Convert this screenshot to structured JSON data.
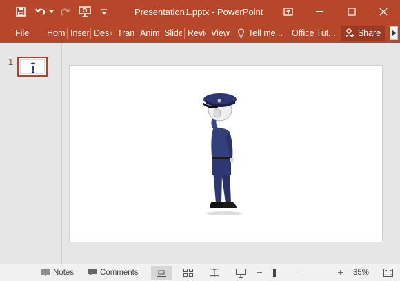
{
  "titlebar": {
    "title": "Presentation1.pptx - PowerPoint",
    "accent_color": "#b7472a",
    "quick_access": [
      "save-icon",
      "undo-icon",
      "undo-dropdown-icon",
      "redo-icon",
      "present-from-start-icon",
      "customize-qat-icon"
    ],
    "window_controls": [
      "ribbon-display-options-icon",
      "minimize-icon",
      "maximize-icon",
      "close-icon"
    ]
  },
  "ribbon": {
    "tabs": [
      {
        "label": "File"
      },
      {
        "label": "Home"
      },
      {
        "label": "Insert"
      },
      {
        "label": "Design"
      },
      {
        "label": "Transitions"
      },
      {
        "label": "Animations"
      },
      {
        "label": "Slide Show"
      },
      {
        "label": "Review"
      },
      {
        "label": "View"
      }
    ],
    "tell_me": "Tell me...",
    "office_tut": "Office Tut...",
    "share": "Share"
  },
  "thumbnails": {
    "items": [
      {
        "number": "1",
        "selected": true
      }
    ]
  },
  "slide": {
    "content_image": "police-officer-stick-figure-saluting"
  },
  "statusbar": {
    "notes": "Notes",
    "comments": "Comments",
    "views": [
      "normal-view-icon",
      "slide-sorter-icon",
      "reading-view-icon",
      "slide-show-icon"
    ],
    "active_view": "normal-view-icon",
    "zoom_percent": "35%",
    "zoom_level": 35
  }
}
